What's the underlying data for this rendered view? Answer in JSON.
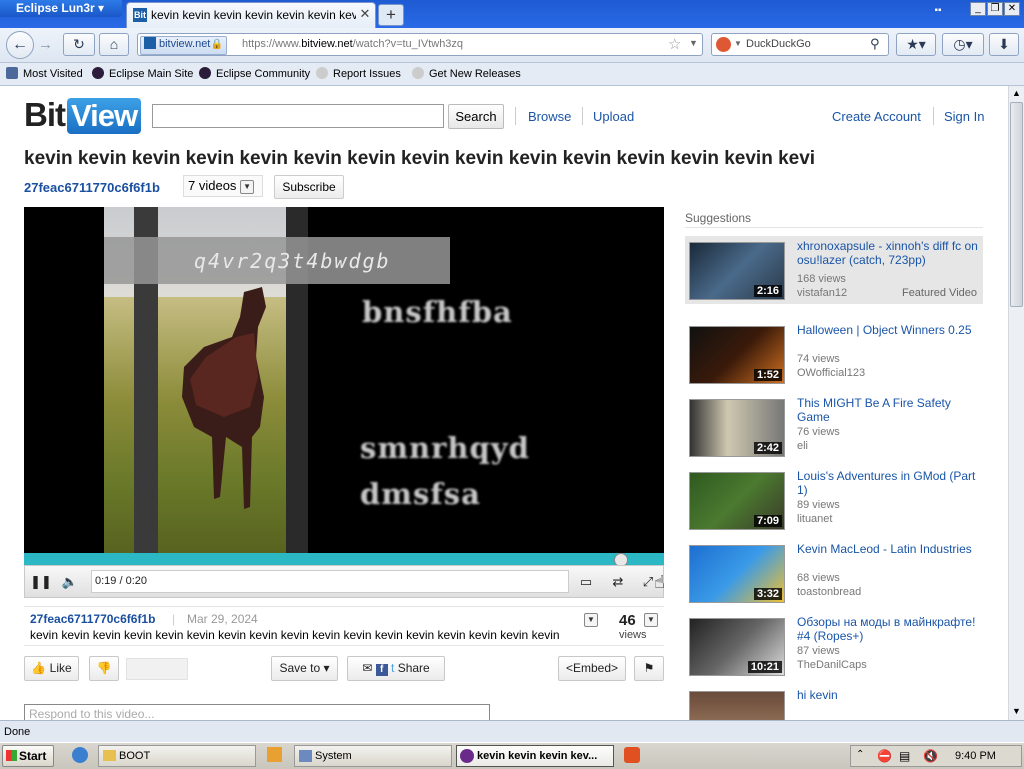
{
  "browser": {
    "app_menu_label": "Eclipse Lun3r",
    "tab_title": "kevin kevin kevin kevin kevin kevin kevin kevin",
    "identity_label": "bitview.net",
    "url_prefix": "https://www.",
    "url_domain": "bitview.net",
    "url_path": "/watch?v=tu_IVtwh3zq",
    "search_engine": "DuckDuckGo",
    "bookmarks": [
      "Most Visited",
      "Eclipse Main Site",
      "Eclipse Community",
      "Report Issues",
      "Get New Releases"
    ],
    "status": "Done"
  },
  "site": {
    "logo_bit": "Bit",
    "logo_view": "View",
    "search_button": "Search",
    "nav": [
      "Browse",
      "Upload"
    ],
    "account_links": [
      "Create Account",
      "Sign In"
    ]
  },
  "video": {
    "title": "kevin kevin kevin kevin kevin kevin kevin kevin kevin kevin kevin kevin kevin kevin kevi",
    "channel": "27feac6711770c6f6f1b",
    "video_count": "7 videos",
    "subscribe": "Subscribe",
    "overlay_caption": "q4vr2q3t4bwdgb",
    "overlay_lines": [
      "bnsfhfba",
      "smnrhqyd",
      "dmsfsa"
    ],
    "time": "0:19 / 0:20",
    "progress": 0.95,
    "upload_date": "Mar 29, 2024",
    "description": "kevin kevin kevin kevin kevin kevin kevin kevin kevin kevin kevin kevin kevin kevin kevin kevin kevin",
    "views": "46",
    "views_label": "views",
    "like": "Like",
    "save_to": "Save to",
    "share": "Share",
    "embed": "<Embed>",
    "comment_placeholder": "Respond to this video..."
  },
  "suggestions": {
    "heading": "Suggestions",
    "featured_label": "Featured Video",
    "items": [
      {
        "title": "xhronoxapsule - xinnoh's diff fc on osu!lazer (catch, 723pp)",
        "views": "168 views",
        "user": "vistafan12",
        "duration": "2:16"
      },
      {
        "title": "Halloween | Object Winners 0.25",
        "views": "74 views",
        "user": "OWofficial123",
        "duration": "1:52"
      },
      {
        "title": "This MIGHT Be A Fire Safety Game",
        "views": "76 views",
        "user": "eli",
        "duration": "2:42"
      },
      {
        "title": "Louis's Adventures in GMod (Part 1)",
        "views": "89 views",
        "user": "lituanet",
        "duration": "7:09"
      },
      {
        "title": "Kevin MacLeod - Latin Industries",
        "views": "68 views",
        "user": "toastonbread",
        "duration": "3:32"
      },
      {
        "title": "Обзоры на моды в майнкрафте! #4 (Ropes+)",
        "views": "87 views",
        "user": "TheDanilCaps",
        "duration": "10:21"
      },
      {
        "title": "hi kevin",
        "views": "",
        "user": "",
        "duration": ""
      }
    ]
  },
  "taskbar": {
    "start": "Start",
    "tasks": [
      "BOOT",
      "System",
      "kevin kevin kevin kev..."
    ],
    "clock": "9:40 PM"
  },
  "colors": {
    "link": "#1a55a8",
    "progress": "#2bb7c4",
    "logo_view": "#1a6fc4"
  }
}
